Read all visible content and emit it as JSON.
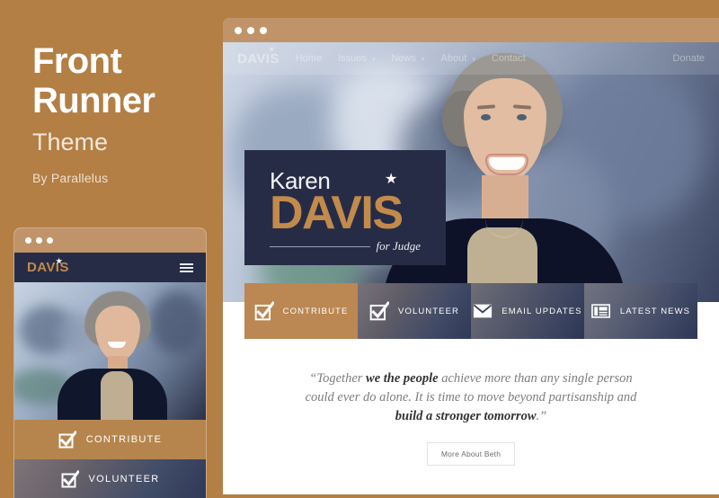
{
  "promo": {
    "title_line1": "Front",
    "title_line2": "Runner",
    "subtitle": "Theme",
    "author": "By Parallelus",
    "bg_color": "#b37f45"
  },
  "mobile_preview": {
    "titlebar_dots": 3,
    "logo": "DAVIS",
    "logo_star": "★",
    "menu_icon": "hamburger-icon",
    "cta_items": [
      {
        "label": "CONTRIBUTE",
        "icon": "checkbox-check-icon",
        "style": "solid-tan"
      },
      {
        "label": "VOLUNTEER",
        "icon": "checkbox-check-icon",
        "style": "photo-overlay"
      }
    ]
  },
  "desktop_preview": {
    "titlebar_dots": 3,
    "nav": {
      "logo": "DAVIS",
      "logo_star": "★",
      "items": [
        {
          "label": "Home",
          "caret": ""
        },
        {
          "label": "Issues",
          "caret": "▾"
        },
        {
          "label": "News",
          "caret": "▾"
        },
        {
          "label": "About",
          "caret": "▾"
        },
        {
          "label": "Contact",
          "caret": ""
        }
      ],
      "donate_label": "Donate"
    },
    "hero_logo": {
      "first_name": "Karen",
      "last_name": "DAVIS",
      "star": "★",
      "tagline": "for Judge",
      "plate_color": "#262c46",
      "accent_color": "#c28a4b"
    },
    "action_buttons": [
      {
        "label": "CONTRIBUTE",
        "icon": "checkbox-check-icon"
      },
      {
        "label": "VOLUNTEER",
        "icon": "checkbox-check-icon"
      },
      {
        "label": "EMAIL UPDATES",
        "icon": "envelope-icon"
      },
      {
        "label": "LATEST NEWS",
        "icon": "newspaper-icon"
      }
    ],
    "quote": {
      "open_mark": "“",
      "part1": "Together ",
      "bold1": "we the people",
      "part2": " achieve more than any single person could ever do alone. It is time to move beyond partisanship and ",
      "bold2": "build a stronger tomorrow",
      "part3": ".",
      "close_mark": "”"
    },
    "about_button": "More About Beth"
  }
}
